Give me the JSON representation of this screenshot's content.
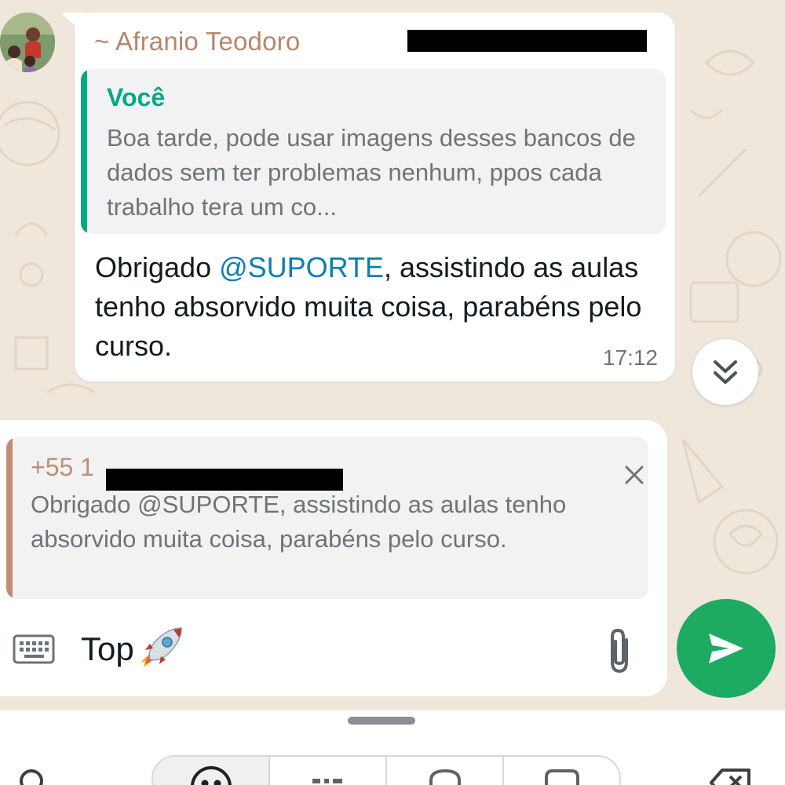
{
  "chat": {
    "message": {
      "sender": "~ Afranio Teodoro",
      "quote": {
        "author": "Você",
        "text": "Boa tarde, pode usar imagens desses bancos de dados sem ter problemas nenhum, ppos cada trabalho tera um co..."
      },
      "text_before_mention": "Obrigado ",
      "mention": "@SUPORTE",
      "text_after_mention": ", assistindo as aulas tenho absorvido muita coisa, parabéns pelo curso.",
      "time": "17:12"
    }
  },
  "composer": {
    "reply": {
      "author_prefix": "+55 1",
      "text": "Obrigado @SUPORTE, assistindo as aulas tenho absorvido muita coisa, parabéns pelo curso."
    },
    "input_value": "Top"
  },
  "icons": {
    "keyboard": "keyboard-icon",
    "attach": "paperclip-icon",
    "send": "send-icon",
    "close": "close-icon",
    "scroll_down": "double-chevron-down-icon",
    "emoji": "emoji-rocket-icon"
  },
  "colors": {
    "accent_green": "#05a884",
    "send_button": "#1daa61",
    "sender_name": "#b8866a",
    "mention": "#0a7fb5"
  }
}
